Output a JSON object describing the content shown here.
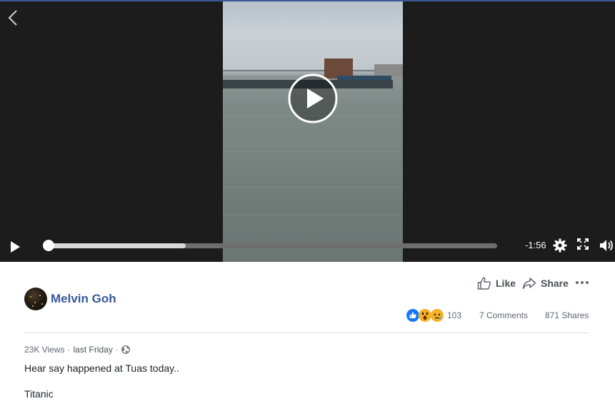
{
  "video": {
    "time_remaining": "-1:56",
    "progress_buffered": 0.31,
    "progress_played": 0.0
  },
  "post": {
    "author": "Melvin Goh",
    "views": "23K Views",
    "separator": "·",
    "posted": "last Friday",
    "caption_lines": [
      "Hear say happened at Tuas today..",
      "Titanic"
    ]
  },
  "actions": {
    "like_label": "Like",
    "share_label": "Share"
  },
  "stats": {
    "reaction_count": "103",
    "comments": "7 Comments",
    "shares": "871 Shares",
    "reaction_icons": [
      "like-reaction-icon",
      "wow-reaction-icon",
      "sad-reaction-icon"
    ]
  },
  "colors": {
    "author_link": "#365899",
    "like_blue": "#1877f2",
    "emoji_yellow": "#f7b125"
  }
}
